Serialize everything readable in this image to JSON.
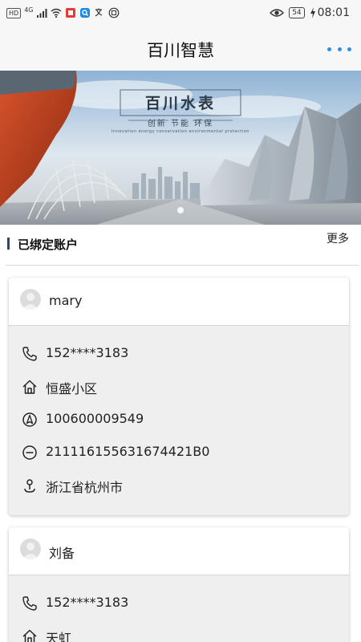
{
  "status_bar": {
    "network_tags": [
      "HD",
      "4G"
    ],
    "battery": "54",
    "time": "08:01"
  },
  "header": {
    "title": "百川智慧"
  },
  "banner": {
    "title": "百川水表",
    "subtitle": "创新  节能  环保",
    "tagline": "Innovation energy conservation environmental protection"
  },
  "section": {
    "title": "已绑定账户",
    "more_label": "更多"
  },
  "accounts": [
    {
      "name": "mary",
      "phone": "152****3183",
      "community": "恒盛小区",
      "account_no": "100600009549",
      "meter_no": "211116155631674421B0",
      "location": "浙江省杭州市"
    },
    {
      "name": "刘备",
      "phone": "152****3183",
      "community": "天虹"
    }
  ],
  "colors": {
    "accent": "#2f8fe8",
    "section_bar": "#2c4a68",
    "card_body": "#efefef"
  },
  "icons": {
    "phone": "phone-icon",
    "community": "home-icon",
    "account_no": "compass-icon",
    "meter_no": "minus-circle-icon",
    "location": "location-pin-icon"
  }
}
